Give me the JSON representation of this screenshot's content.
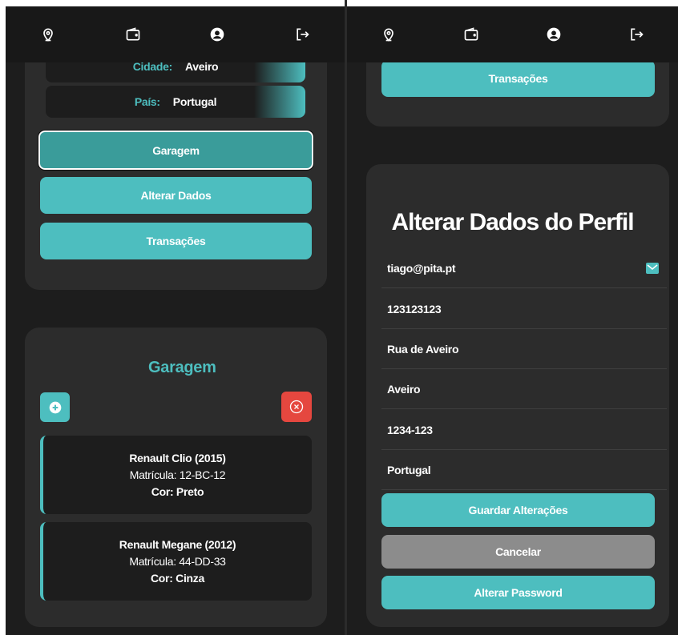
{
  "left": {
    "profile": {
      "city_label": "Cidade:",
      "city_value": "Aveiro",
      "country_label": "País:",
      "country_value": "Portugal"
    },
    "buttons": {
      "garage": "Garagem",
      "change_data": "Alterar Dados",
      "transactions": "Transações"
    },
    "garage": {
      "title": "Garagem",
      "cars": [
        {
          "model": "Renault Clio (2015)",
          "plate": "Matrícula: 12-BC-12",
          "color": "Cor: Preto"
        },
        {
          "model": "Renault Megane (2012)",
          "plate": "Matrícula: 44-DD-33",
          "color": "Cor: Cinza"
        }
      ]
    }
  },
  "right": {
    "buttons": {
      "transactions": "Transações"
    },
    "form": {
      "title": "Alterar Dados do Perfil",
      "fields": {
        "email": "tiago@pita.pt",
        "phone": "123123123",
        "street": "Rua de Aveiro",
        "city": "Aveiro",
        "postal_code": "1234-123",
        "country": "Portugal"
      },
      "save": "Guardar Alterações",
      "cancel": "Cancelar",
      "change_password": "Alterar Password"
    }
  },
  "colors": {
    "accent": "#4dbebf",
    "accent_dark": "#3a9c9a",
    "danger": "#e5473f",
    "grey_button": "#8c8c8c",
    "background": "#1d1d1d",
    "card": "#2c2c2c"
  },
  "icons": [
    "location-pin-icon",
    "wallet-icon",
    "user-circle-icon",
    "logout-icon",
    "plus-circle-icon",
    "close-circle-icon",
    "mail-icon"
  ]
}
